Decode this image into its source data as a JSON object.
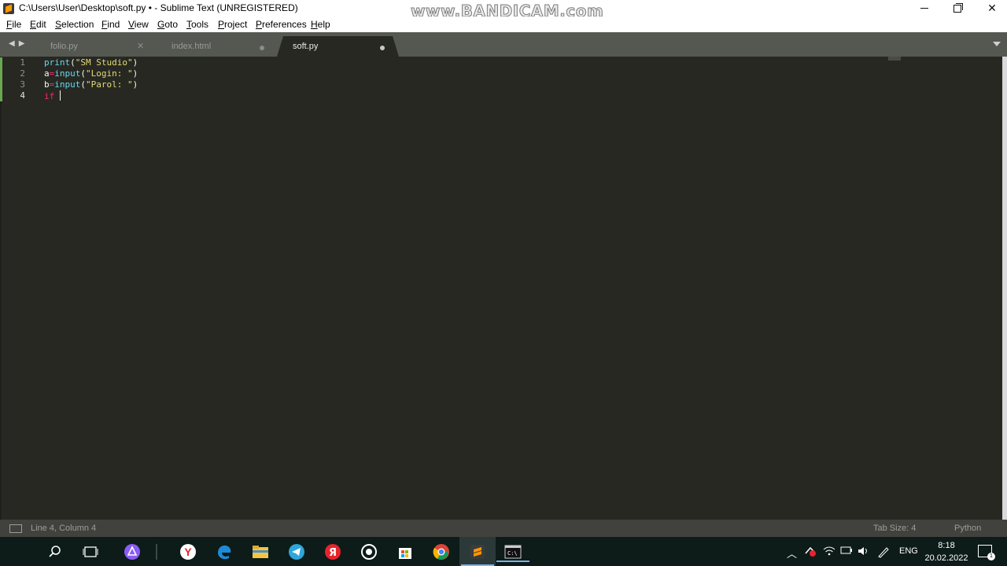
{
  "window": {
    "title": "C:\\Users\\User\\Desktop\\soft.py • - Sublime Text (UNREGISTERED)",
    "watermark": "www.BANDICAM.com",
    "minimize_icon": "minimize-icon",
    "maximize_icon": "restore-icon",
    "close_label": "✕"
  },
  "menu": {
    "items": [
      "File",
      "Edit",
      "Selection",
      "Find",
      "View",
      "Goto",
      "Tools",
      "Project",
      "Preferences",
      "Help"
    ]
  },
  "tabs": [
    {
      "label": "folio.py",
      "state": "saved",
      "close_glyph": "✕"
    },
    {
      "label": "index.html",
      "state": "modified"
    },
    {
      "label": "soft.py",
      "state": "modified",
      "active": true
    }
  ],
  "editor": {
    "lines": [
      {
        "number": "1",
        "tokens": [
          {
            "t": "print",
            "c": "fn"
          },
          {
            "t": "(",
            "c": "plain"
          },
          {
            "t": "\"SM Studio\"",
            "c": "str"
          },
          {
            "t": ")",
            "c": "plain"
          }
        ]
      },
      {
        "number": "2",
        "tokens": [
          {
            "t": "a",
            "c": "plain"
          },
          {
            "t": "=",
            "c": "kw"
          },
          {
            "t": "input",
            "c": "fn"
          },
          {
            "t": "(",
            "c": "plain"
          },
          {
            "t": "\"Login: \"",
            "c": "str"
          },
          {
            "t": ")",
            "c": "plain"
          }
        ]
      },
      {
        "number": "3",
        "tokens": [
          {
            "t": "b",
            "c": "plain"
          },
          {
            "t": "=",
            "c": "kw"
          },
          {
            "t": "input",
            "c": "fn"
          },
          {
            "t": "(",
            "c": "plain"
          },
          {
            "t": "\"Parol: \"",
            "c": "str"
          },
          {
            "t": ")",
            "c": "plain"
          }
        ]
      },
      {
        "number": "4",
        "tokens": [
          {
            "t": "if",
            "c": "kw"
          },
          {
            "t": " ",
            "c": "plain"
          }
        ]
      }
    ],
    "current_line": 4
  },
  "status": {
    "position": "Line 4, Column 4",
    "tab_size": "Tab Size: 4",
    "syntax": "Python"
  },
  "taskbar": {
    "apps": [
      "windows-start-icon",
      "search-icon",
      "task-view-icon",
      "alice-icon",
      "yandex-browser-icon",
      "edge-icon",
      "file-explorer-icon",
      "telegram-icon",
      "yandex-icon",
      "obs-icon",
      "store-icon",
      "chrome-icon",
      "sublime-text-icon",
      "terminal-icon"
    ],
    "tray_language": "ENG",
    "clock_time": "8:18",
    "clock_date": "20.02.2022",
    "notifications_count": "1"
  },
  "colors": {
    "editor_bg": "#272822",
    "keyword": "#f92672",
    "function": "#66d9ef",
    "string": "#e6db74",
    "text": "#f8f8f2",
    "taskbar_bg": "#0d1b19"
  }
}
